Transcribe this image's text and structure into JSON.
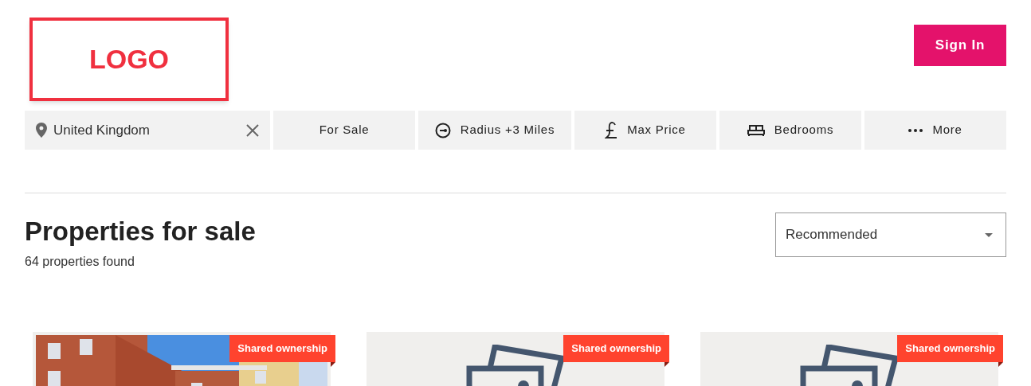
{
  "logo": "LOGO",
  "sign_in": "Sign In",
  "location": {
    "value": "United Kingdom"
  },
  "filters": [
    {
      "kind": "plain",
      "label": "For Sale"
    },
    {
      "kind": "radius",
      "label": "Radius +3 Miles"
    },
    {
      "kind": "price",
      "label": "Max Price"
    },
    {
      "kind": "bedrooms",
      "label": "Bedrooms"
    },
    {
      "kind": "more",
      "label": "More"
    }
  ],
  "heading": "Properties for sale",
  "count": "64 properties found",
  "sort": {
    "value": "Recommended"
  },
  "cards": [
    {
      "kind": "picture",
      "badge": "Shared ownership"
    },
    {
      "kind": "placeholder",
      "badge": "Shared ownership"
    },
    {
      "kind": "placeholder",
      "badge": "Shared ownership"
    }
  ]
}
